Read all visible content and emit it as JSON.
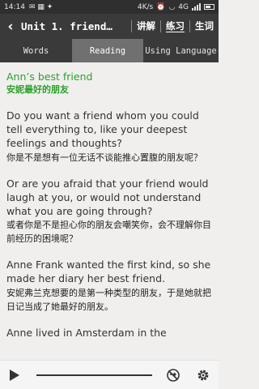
{
  "status_bar": {
    "time": "14:14",
    "network": "4K/s",
    "carrier": "4G"
  },
  "app_bar": {
    "title": "Unit 1. friend…",
    "actions": [
      {
        "label": "讲解"
      },
      {
        "label": "练习"
      },
      {
        "label": "生词"
      }
    ]
  },
  "tabs": [
    {
      "label": "Words"
    },
    {
      "label": "Reading"
    },
    {
      "label": "Using Language"
    }
  ],
  "content": {
    "heading_en": "Ann’s best friend",
    "heading_zh": "安妮最好的朋友",
    "paragraphs": [
      {
        "en": "Do you want a friend whom you could tell everything to, like your deepest feelings and thoughts?",
        "zh": "你是不是想有一位无话不谈能推心置腹的朋友呢？"
      },
      {
        "en": "Or are you afraid that your friend would laugh at you, or would not understand what you are going through?",
        "zh": "或者你是不是担心你的朋友会嘲笑你，会不理解你目前经历的困境呢？"
      },
      {
        "en": "Anne Frank wanted the first kind, so she made her diary her best friend.",
        "zh": "安妮弗兰克想要的是第一种类型的朋友，于是她就把日记当成了她最好的朋友。"
      },
      {
        "en": "Anne lived in Amsterdam in the",
        "zh": ""
      }
    ]
  },
  "player": {
    "progress": 0
  },
  "colors": {
    "accent_green": "#2aa12a",
    "toolbar": "#3a3a3a",
    "selected_tab": "#707070"
  }
}
